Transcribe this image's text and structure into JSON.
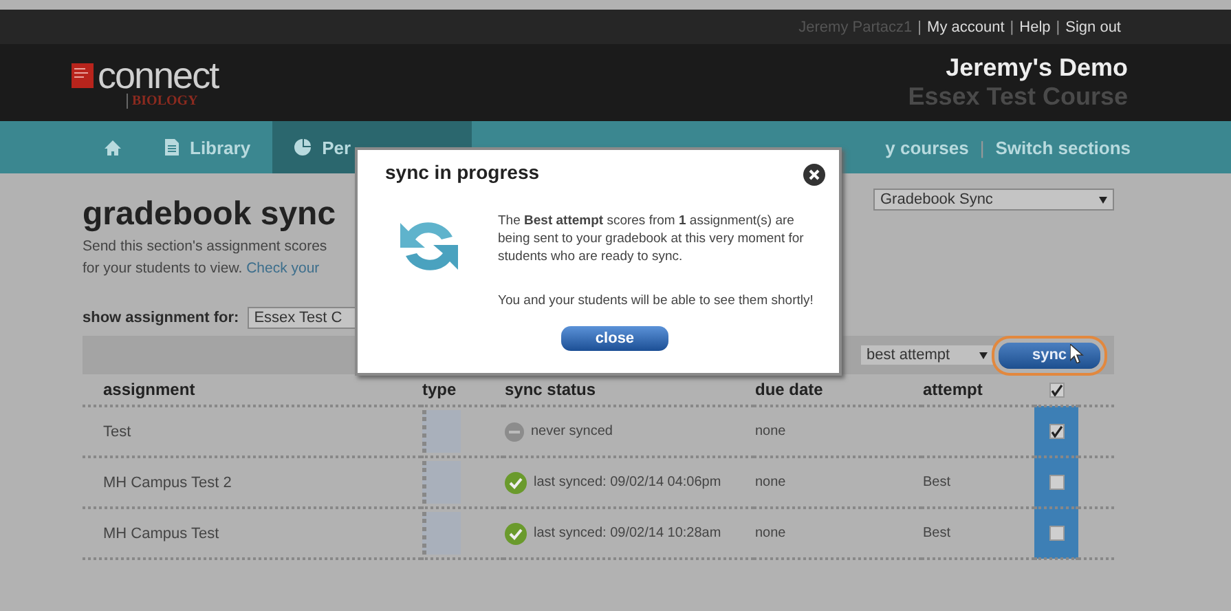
{
  "top_bar": {
    "user": "Jeremy Partacz1",
    "items": [
      {
        "kind": "separator",
        "text": "|"
      },
      {
        "kind": "link",
        "text": "My account"
      },
      {
        "kind": "separator",
        "text": "|"
      },
      {
        "kind": "link",
        "text": "Help"
      },
      {
        "kind": "separator",
        "text": "|"
      },
      {
        "kind": "link",
        "text": "Sign out"
      }
    ]
  },
  "header": {
    "logo_text": "connect",
    "logo_subject": "BIOLOGY",
    "title": "Jeremy's Demo",
    "course": "Essex Test Course"
  },
  "nav": {
    "tabs": [
      {
        "kind": "home",
        "selected": false
      },
      {
        "label": "Library",
        "kind": "doc",
        "selected": false
      },
      {
        "label": "Per",
        "kind": "pie",
        "selected": true
      }
    ],
    "right_items": [
      {
        "kind": "link",
        "text": "y courses"
      },
      {
        "kind": "separator",
        "text": "|"
      },
      {
        "kind": "link",
        "text": "Switch sections"
      }
    ]
  },
  "page": {
    "title": "gradebook sync",
    "description_line_1": "Send this section's assignment scores",
    "description_line_2": "for your students to view.",
    "link": "Check your",
    "view_select": "Gradebook Sync",
    "filter_label": "show assignment for:",
    "filter_value": "Essex Test C",
    "attempt_select": "best attempt",
    "sync_button": "sync"
  },
  "table": {
    "columns": [
      "assignment",
      "type",
      "sync status",
      "due date",
      "attempt"
    ],
    "all_checked": true,
    "rows": [
      {
        "assignment": "Test",
        "kind": "never",
        "status": "never synced",
        "due_date": "none",
        "checked": true
      },
      {
        "assignment": "MH Campus Test 2",
        "kind": "synced",
        "status": "last synced: 09/02/14 04:06pm",
        "due_date": "none",
        "attempt": "Best",
        "checked": false
      },
      {
        "assignment": "MH Campus Test",
        "kind": "synced",
        "status": "last synced: 09/02/14 10:28am",
        "due_date": "none",
        "attempt": "Best",
        "checked": false
      }
    ]
  },
  "dialog": {
    "title": "sync in progress",
    "message": "The **Best attempt** scores from **1** assignment(s) are being sent to your gradebook at this very moment for students who are ready to sync.",
    "note": "You and your students will be able to see them shortly!",
    "button": "close"
  }
}
